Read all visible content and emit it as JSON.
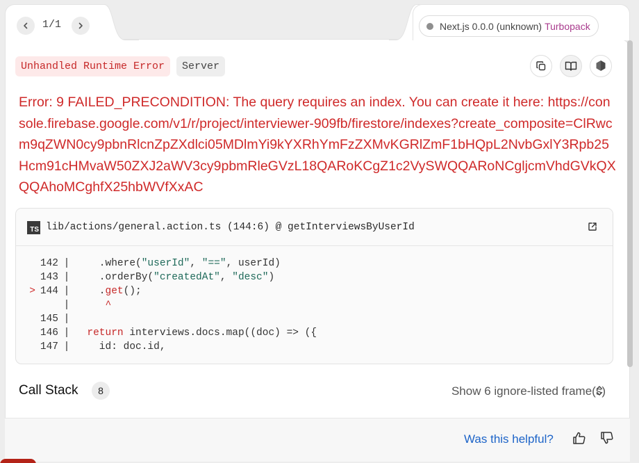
{
  "nav": {
    "counter": "1/1",
    "prev_icon": "chevron-left-icon",
    "next_icon": "chevron-right-icon"
  },
  "version": {
    "label": "Next.js 0.0.0 (unknown)",
    "bundler": "Turbopack"
  },
  "badges": {
    "error_type": "Unhandled Runtime Error",
    "environment": "Server"
  },
  "toolbar": {
    "copy_icon": "copy-icon",
    "docs_icon": "book-icon",
    "nodejs_icon": "nodejs-icon"
  },
  "error": {
    "message": "Error: 9 FAILED_PRECONDITION: The query requires an index. You can create it here: https://console.firebase.google.com/v1/r/project/interviewer-909fb/firestore/indexes?create_composite=ClRwcm9qZWN0cy9pbnRlcnZpZXdlci05MDlmYi9kYXRhYmFzZXMvKGRlZmF1bHQpL2NvbGxlY3Rpb25Hcm91cHMvaW50ZXJ2aWV3cy9pbmRleGVzL18QARoKCgZ1c2VySWQQARoNCgljcmVhdGVkQXQQAhoMCghfX25hbWVfXxAC"
  },
  "code_frame": {
    "file_path": "lib/actions/general.action.ts (144:6) @ getInterviewsByUserId",
    "file_icon": "typescript-icon",
    "open_icon": "external-link-icon",
    "lines": [
      {
        "marker": "",
        "num": "142",
        "bar": "|",
        "code": "    .where(\"userId\", \"==\", userId)"
      },
      {
        "marker": "",
        "num": "143",
        "bar": "|",
        "code": "    .orderBy(\"createdAt\", \"desc\")"
      },
      {
        "marker": ">",
        "num": "144",
        "bar": "|",
        "code": "    .get();"
      },
      {
        "marker": "",
        "num": "",
        "bar": "|",
        "code": "     ^"
      },
      {
        "marker": "",
        "num": "145",
        "bar": "|",
        "code": ""
      },
      {
        "marker": "",
        "num": "146",
        "bar": "|",
        "code": "  return interviews.docs.map((doc) => ({"
      },
      {
        "marker": "",
        "num": "147",
        "bar": "|",
        "code": "    id: doc.id,"
      }
    ]
  },
  "call_stack": {
    "title": "Call Stack",
    "count": "8",
    "toggle_label": "Show 6 ignore-listed frame(s)",
    "toggle_icon": "chevron-up-down-icon"
  },
  "footer": {
    "helpful_label": "Was this helpful?",
    "thumbs_up_icon": "thumbs-up-icon",
    "thumbs_down_icon": "thumbs-down-icon"
  },
  "colors": {
    "error_red": "#cf2a2a",
    "turbopack": "#a93b8d",
    "link_blue": "#1d64c8"
  }
}
